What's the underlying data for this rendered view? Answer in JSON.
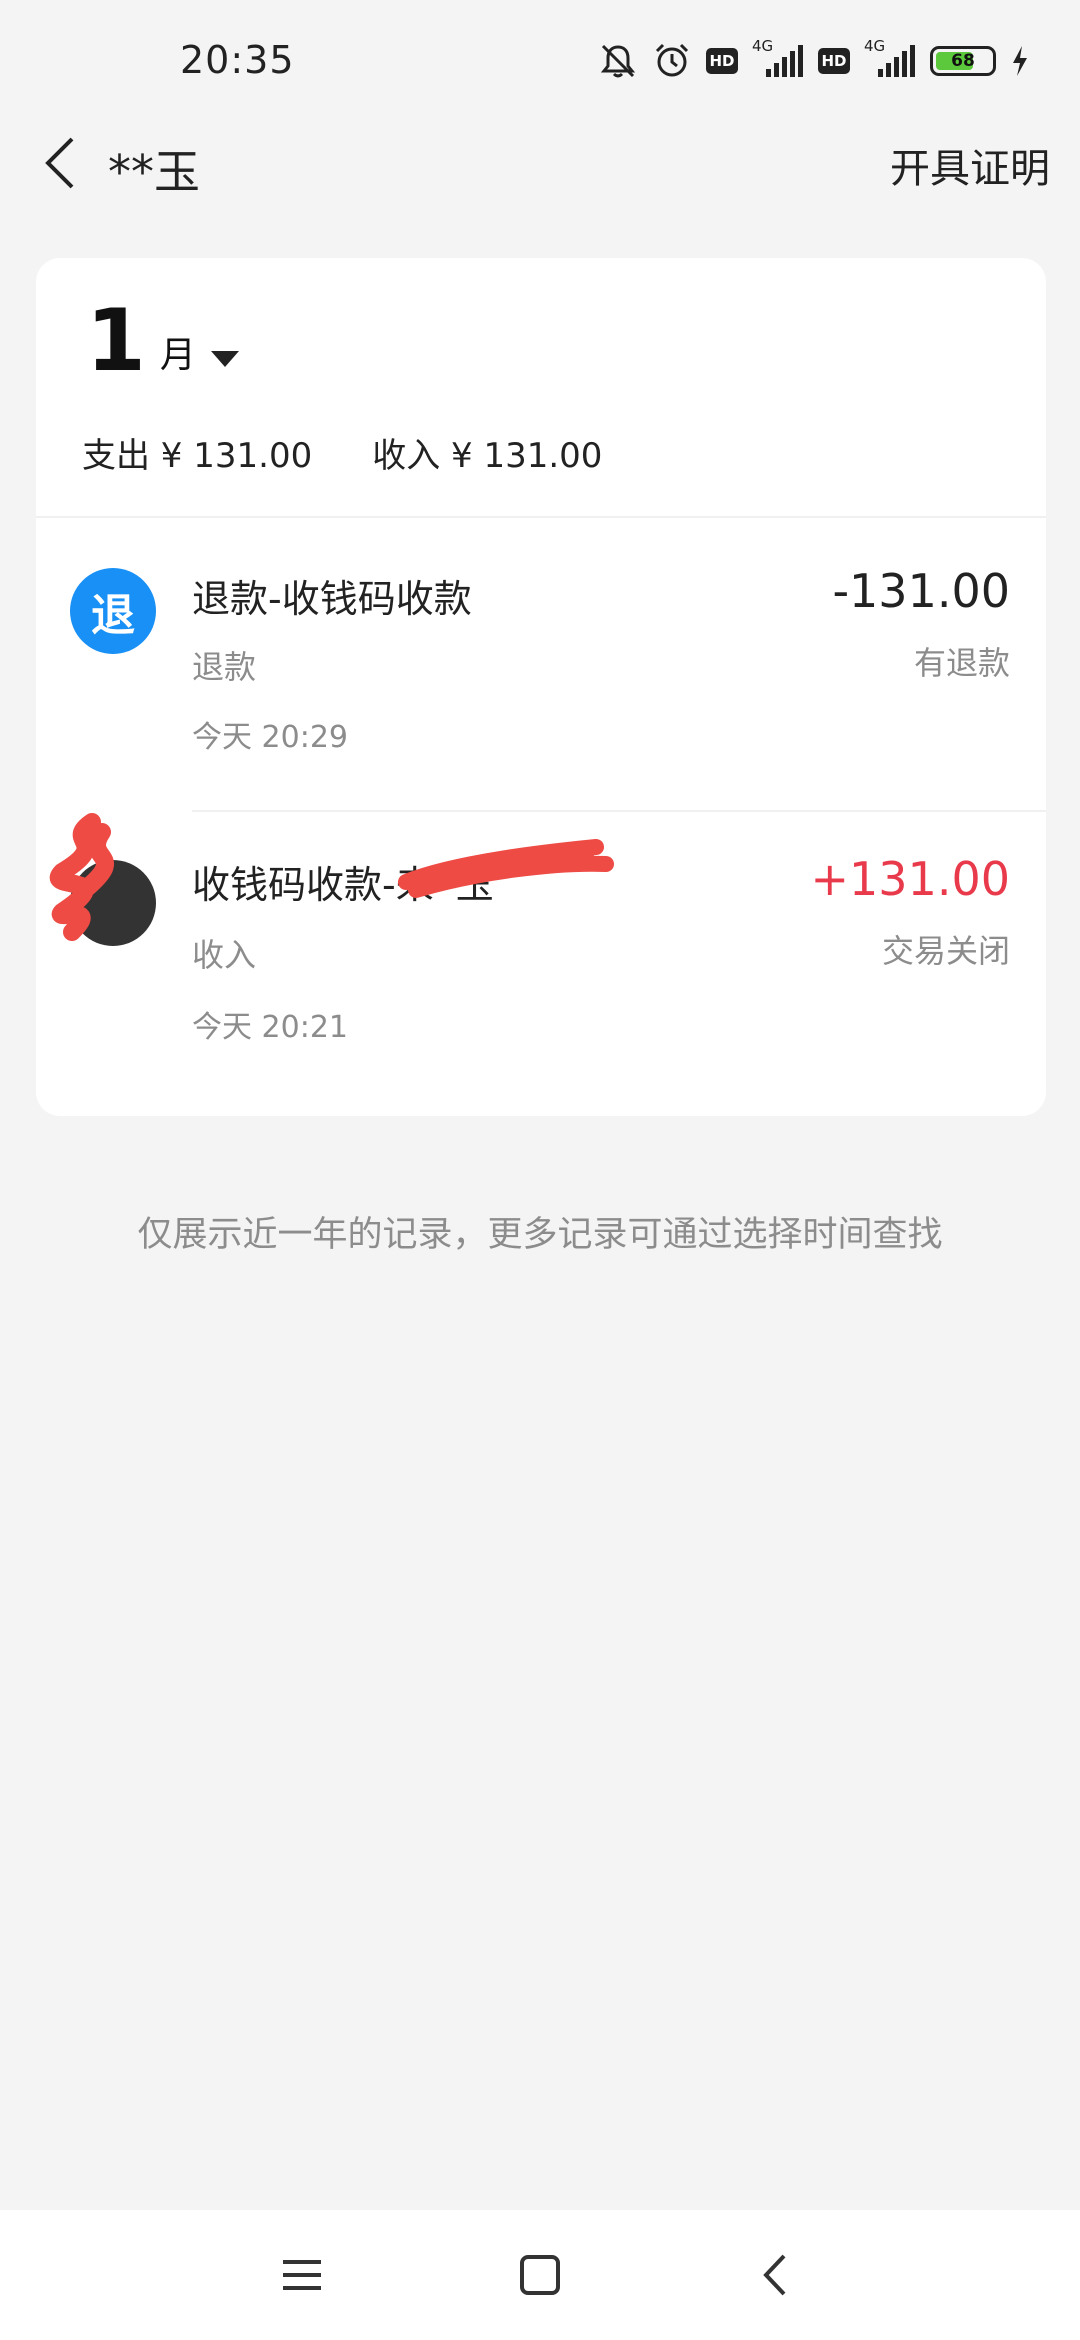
{
  "status_bar": {
    "time": "20:35",
    "hd_label": "HD",
    "network_label": "4G",
    "battery_level": "68",
    "battery_fraction": 0.68,
    "icons": [
      "mute-bell-icon",
      "alarm-icon",
      "hd-icon",
      "signal-icon",
      "hd-icon",
      "signal-icon",
      "battery-icon",
      "charging-icon"
    ]
  },
  "header": {
    "title": "**玉",
    "action_label": "开具证明",
    "back_icon": "chevron-left-icon"
  },
  "summary": {
    "month_number": "1",
    "month_unit": "月",
    "expense": "支出 ¥ 131.00",
    "income": "收入 ¥ 131.00"
  },
  "transactions": [
    {
      "avatar_text": "退",
      "avatar_color": "#1890f5",
      "title": "退款-收钱码收款",
      "category": "退款",
      "time": "今天 20:29",
      "amount": "-131.00",
      "amount_color": "#222222",
      "status": "有退款"
    },
    {
      "avatar_text": "",
      "avatar_color": "#333333",
      "title": "收钱码收款-来",
      "title_tail": "玉",
      "category": "收入",
      "time": "今天 20:21",
      "amount": "+131.00",
      "amount_color": "#e83a4a",
      "status": "交易关闭"
    }
  ],
  "footer_note": "仅展示近一年的记录，更多记录可通过选择时间查找",
  "redaction_color": "#ee4b45",
  "nav_bar": {
    "icons": [
      "menu-icon",
      "home-square-icon",
      "back-triangle-icon"
    ]
  }
}
